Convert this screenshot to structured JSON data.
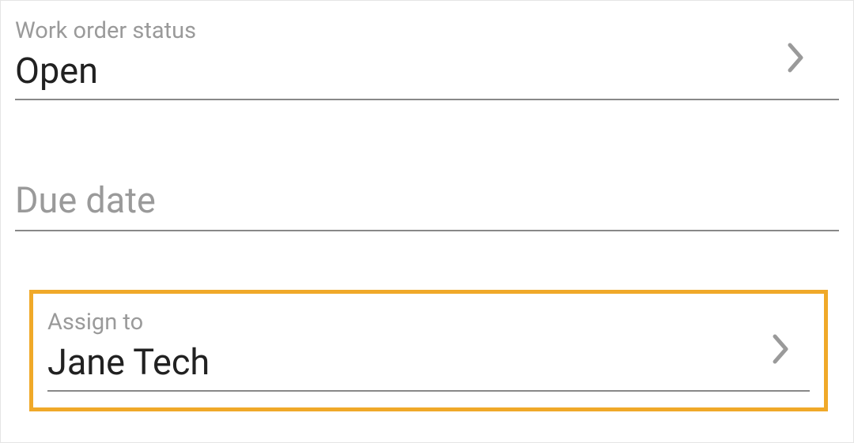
{
  "fields": {
    "status": {
      "label": "Work order status",
      "value": "Open"
    },
    "dueDate": {
      "placeholder": "Due date"
    },
    "assignTo": {
      "label": "Assign to",
      "value": "Jane Tech"
    }
  }
}
